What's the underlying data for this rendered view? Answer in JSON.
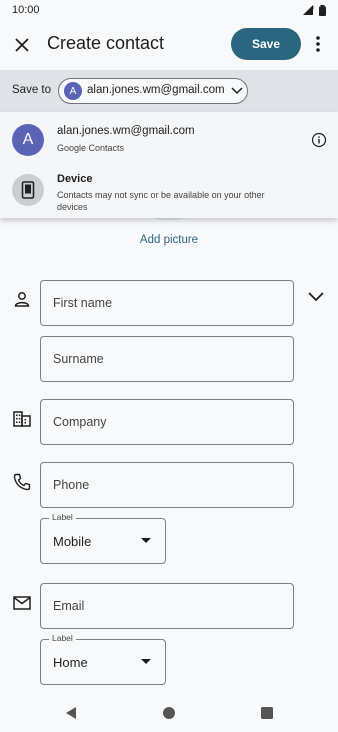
{
  "status_bar": {
    "time": "10:00"
  },
  "app_bar": {
    "title": "Create contact",
    "save_label": "Save"
  },
  "save_to": {
    "label": "Save to",
    "account_initial": "A",
    "account_email": "alan.jones.wm@gmail.com"
  },
  "dropdown": {
    "items": [
      {
        "avatar": "A",
        "title": "alan.jones.wm@gmail.com",
        "subtitle": "Google Contacts"
      },
      {
        "title": "Device",
        "subtitle": "Contacts may not sync or be available on your other devices"
      }
    ]
  },
  "photo": {
    "add_label": "Add picture"
  },
  "form": {
    "first_name_placeholder": "First name",
    "surname_placeholder": "Surname",
    "company_placeholder": "Company",
    "phone_placeholder": "Phone",
    "phone_label_caption": "Label",
    "phone_label_value": "Mobile",
    "email_placeholder": "Email",
    "email_label_caption": "Label",
    "email_label_value": "Home"
  },
  "colors": {
    "accent": "#2b6680",
    "avatar": "#5b63b5",
    "background": "#f7f9fb"
  }
}
